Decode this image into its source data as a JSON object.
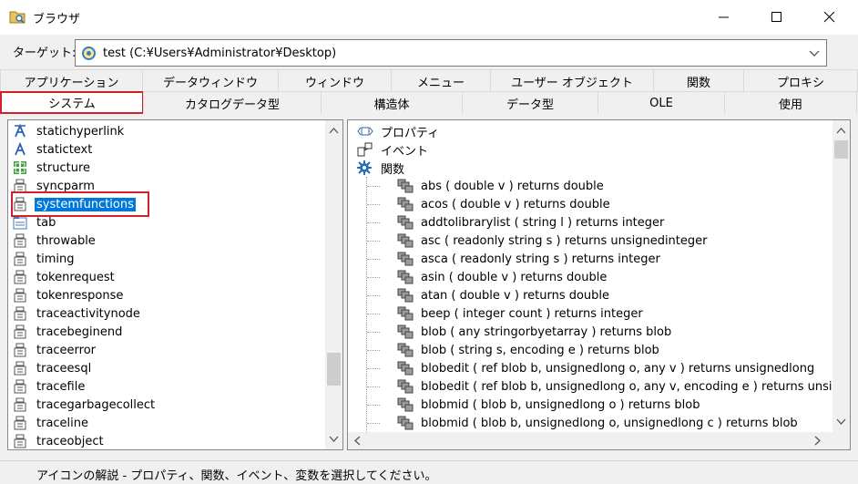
{
  "window": {
    "title": "ブラウザ"
  },
  "target": {
    "label": "ターゲット:",
    "value": "test (C:¥Users¥Administrator¥Desktop)"
  },
  "tabs_row1": [
    "アプリケーション",
    "データウィンドウ",
    "ウィンドウ",
    "メニュー",
    "ユーザー オブジェクト",
    "関数",
    "プロキシ"
  ],
  "tabs_row2": [
    "システム",
    "カタログデータ型",
    "構造体",
    "データ型",
    "OLE",
    "使用"
  ],
  "selected_tab": "システム",
  "left_list": [
    {
      "label": "statichyperlink",
      "icon": "statichyperlink-icon"
    },
    {
      "label": "statictext",
      "icon": "statictext-icon"
    },
    {
      "label": "structure",
      "icon": "structure-icon"
    },
    {
      "label": "syncparm",
      "icon": "object-icon"
    },
    {
      "label": "systemfunctions",
      "icon": "object-icon"
    },
    {
      "label": "tab",
      "icon": "tab-icon"
    },
    {
      "label": "throwable",
      "icon": "object-icon"
    },
    {
      "label": "timing",
      "icon": "object-icon"
    },
    {
      "label": "tokenrequest",
      "icon": "object-icon"
    },
    {
      "label": "tokenresponse",
      "icon": "object-icon"
    },
    {
      "label": "traceactivitynode",
      "icon": "object-icon"
    },
    {
      "label": "tracebeginend",
      "icon": "object-icon"
    },
    {
      "label": "traceerror",
      "icon": "object-icon"
    },
    {
      "label": "traceesql",
      "icon": "object-icon"
    },
    {
      "label": "tracefile",
      "icon": "object-icon"
    },
    {
      "label": "tracegarbagecollect",
      "icon": "object-icon"
    },
    {
      "label": "traceline",
      "icon": "object-icon"
    },
    {
      "label": "traceobject",
      "icon": "object-icon"
    }
  ],
  "selected_item": "systemfunctions",
  "tree_top": [
    {
      "label": "プロパティ",
      "icon": "property-icon"
    },
    {
      "label": "イベント",
      "icon": "event-icon"
    },
    {
      "label": "関数",
      "icon": "function-gear-icon"
    }
  ],
  "functions": [
    "abs ( double v )  returns double",
    "acos ( double v )  returns double",
    "addtolibrarylist ( string l )  returns integer",
    "asc ( readonly string s )  returns unsignedinteger",
    "asca ( readonly string s )  returns integer",
    "asin ( double v )  returns double",
    "atan ( double v )  returns double",
    "beep ( integer count )  returns integer",
    "blob ( any stringorbyetarray )  returns blob",
    "blob ( string s, encoding e )  returns blob",
    "blobedit ( ref blob b, unsignedlong o, any v )  returns unsignedlong",
    "blobedit ( ref blob b, unsignedlong o, any v, encoding e )  returns unsignedlong",
    "blobmid ( blob b, unsignedlong o )  returns blob",
    "blobmid ( blob b, unsignedlong o, unsignedlong c )  returns blob"
  ],
  "status": {
    "text": "アイコンの解説 - プロパティ、関数、イベント、変数を選択してください。"
  }
}
